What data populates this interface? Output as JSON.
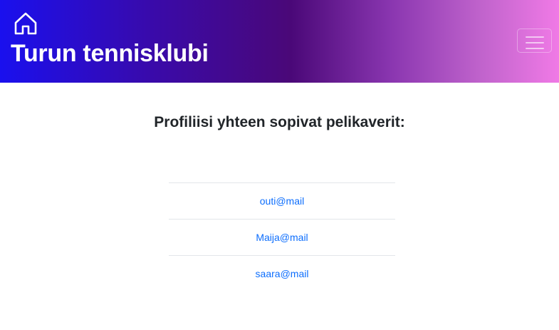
{
  "header": {
    "brand": "Turun tennisklubi",
    "home_icon": "home-icon",
    "menu_icon": "hamburger-menu-icon"
  },
  "main": {
    "title": "Profiliisi yhteen sopivat pelikaverit:",
    "matches": [
      {
        "email": "outi@mail"
      },
      {
        "email": "Maija@mail"
      },
      {
        "email": "saara@mail"
      }
    ]
  },
  "colors": {
    "gradient_start": "#1a10ee",
    "gradient_mid": "#4a0878",
    "gradient_end": "#f07ae6",
    "link": "#0d6efd"
  }
}
